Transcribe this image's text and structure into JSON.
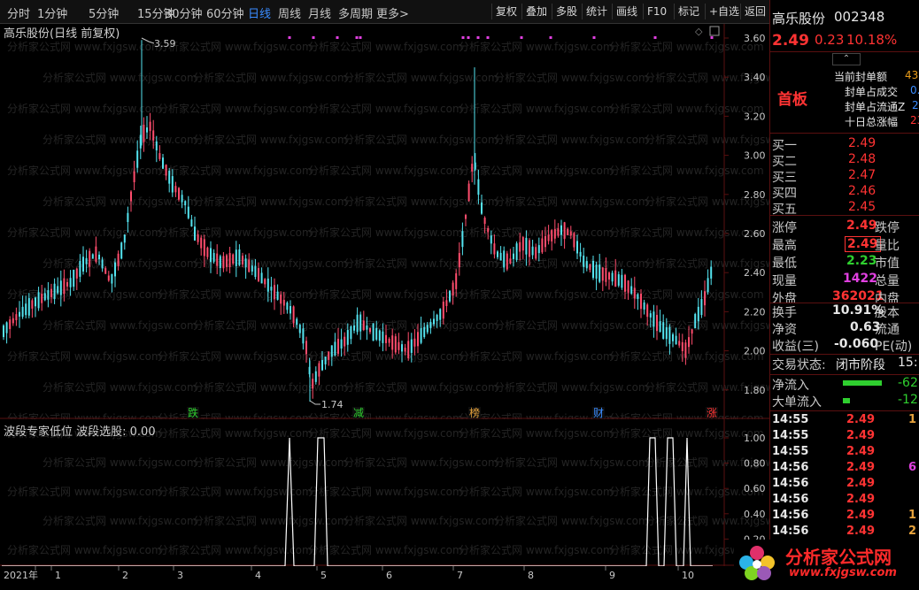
{
  "toolbar": {
    "periods": [
      "分时",
      "1分钟",
      "5分钟",
      "15分钟",
      "30分钟",
      "60分钟",
      "日线",
      "周线",
      "月线",
      "多周期",
      "更多>"
    ],
    "active_period": "日线",
    "right_buttons": [
      "复权",
      "叠加",
      "多股",
      "统计",
      "画线",
      "F10",
      "标记",
      "+自选",
      "返回"
    ]
  },
  "chart": {
    "title": "高乐股份(日线 前复权)",
    "high_label": "3.59",
    "low_label": "1.74",
    "y_ticks": [
      "3.60",
      "3.40",
      "3.20",
      "3.00",
      "2.80",
      "2.60",
      "2.40",
      "2.20",
      "2.00",
      "1.80"
    ],
    "event_tags": [
      {
        "text": "跌",
        "color": "#2fcf2f"
      },
      {
        "text": "减",
        "color": "#2fcf2f"
      },
      {
        "text": "榜",
        "color": "#e6a23c"
      },
      {
        "text": "财",
        "color": "#3a8cff"
      },
      {
        "text": "涨",
        "color": "#ff3333"
      }
    ],
    "watermark": "分析家公式网 www.fxjgsw.com"
  },
  "indicator": {
    "title": "波段专家低位 波段选股: 0.00",
    "y_ticks": [
      "1.00",
      "0.80",
      "0.60",
      "0.40",
      "0.20"
    ]
  },
  "x_axis": {
    "labels": [
      "2021年",
      "1",
      "2",
      "3",
      "4",
      "5",
      "6",
      "7",
      "8",
      "9",
      "10"
    ]
  },
  "stock": {
    "name": "高乐股份",
    "code": "002348",
    "price": "2.49",
    "change": "0.23",
    "change_pct": "10.18%",
    "tag": "首板",
    "seal_items": [
      "当前封单额",
      "封单占成交",
      "封单占流通Z",
      "十日总涨幅"
    ],
    "seal_values": [
      "43",
      "0.",
      "2",
      "23"
    ]
  },
  "bids": [
    {
      "label": "买一",
      "price": "2.49"
    },
    {
      "label": "买二",
      "price": "2.48"
    },
    {
      "label": "买三",
      "price": "2.47"
    },
    {
      "label": "买四",
      "price": "2.46"
    },
    {
      "label": "买五",
      "price": "2.45"
    }
  ],
  "quote": {
    "limit_up_label": "涨停",
    "limit_up": "2.49",
    "limit_down_label": "跌停",
    "high_label": "最高",
    "high": "2.49",
    "vol_ratio_label": "量比",
    "low_label": "最低",
    "low": "2.23",
    "mktcap_label": "市值",
    "cur_vol_label": "现量",
    "cur_vol": "1422",
    "total_vol_label": "总量",
    "outer_label": "外盘",
    "outer": "362021",
    "inner_label": "内盘",
    "turnover_label": "换手",
    "turnover": "10.91%",
    "equity_label": "股本",
    "nav_label": "净资",
    "nav": "0.63",
    "float_label": "流通",
    "eps_label": "收益(三)",
    "eps": "-0.060",
    "pe_label": "PE(动)",
    "status_label": "交易状态:",
    "status": "闭市阶段",
    "status_time": "15:",
    "netflow_label": "净流入",
    "netflow": "-62",
    "bigflow_label": "大单流入",
    "bigflow": "-12"
  },
  "ticks": [
    {
      "time": "14:55",
      "price": "2.49",
      "vol": "1"
    },
    {
      "time": "14:55",
      "price": "2.49",
      "vol": ""
    },
    {
      "time": "14:55",
      "price": "2.49",
      "vol": ""
    },
    {
      "time": "14:56",
      "price": "2.49",
      "vol": "6"
    },
    {
      "time": "14:56",
      "price": "2.49",
      "vol": ""
    },
    {
      "time": "14:56",
      "price": "2.49",
      "vol": ""
    },
    {
      "time": "14:56",
      "price": "2.49",
      "vol": "1"
    },
    {
      "time": "14:56",
      "price": "2.49",
      "vol": "2"
    }
  ],
  "logo": {
    "text": "分析家公式网",
    "url": "www.fxjgsw.com"
  }
}
